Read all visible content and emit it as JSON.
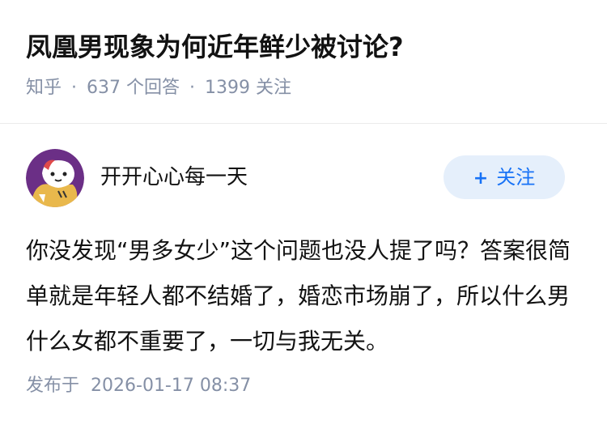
{
  "question": {
    "title": "凤凰男现象为何近年鲜少被讨论?",
    "source": "知乎",
    "answer_count": "637",
    "answer_label": "个回答",
    "follower_count": "1399",
    "follower_label": "关注"
  },
  "answer": {
    "author_name": "开开心心每一天",
    "follow_label": "关注",
    "content": "你没发现“男多女少”这个问题也没人提了吗？答案很简单就是年轻人都不结婚了，婚恋市场崩了，所以什么男什么女都不重要了，一切与我无关。",
    "published_label": "发布于",
    "published_time": "2026-01-17 08:37"
  },
  "colors": {
    "accent": "#1772f6",
    "follow_bg": "#e5effb",
    "meta_text": "#8590a6",
    "avatar_bg": "#6b2f86"
  },
  "icons": {
    "avatar": "cartoon-avatar",
    "follow": "plus-icon"
  }
}
